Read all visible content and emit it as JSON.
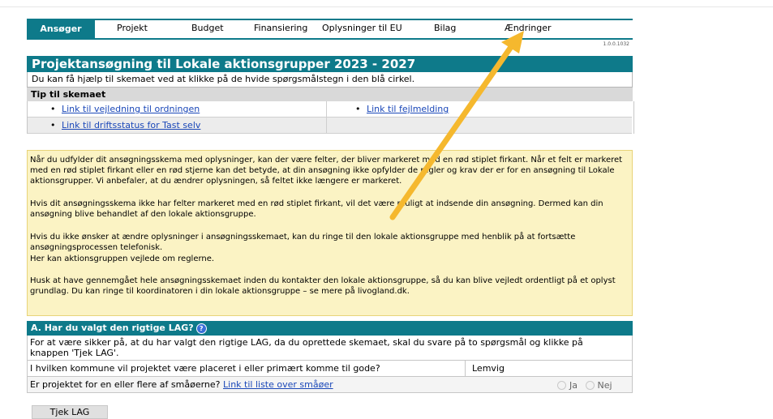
{
  "tabs": [
    "Ansøger",
    "Projekt",
    "Budget",
    "Finansiering",
    "Oplysninger til EU",
    "Bilag",
    "Ændringer"
  ],
  "active_tab": "Ansøger",
  "version": "1.0.0.1032",
  "title": "Projektansøgning til Lokale aktionsgrupper 2023 - 2027",
  "help_text": "Du kan få hjælp til skemaet ved at klikke på de hvide spørgsmålstegn i den blå cirkel.",
  "tips": {
    "heading": "Tip til skemaet",
    "links": {
      "guide": "Link til vejledning til ordningen",
      "error": "Link til fejlmelding",
      "status": "Link til driftsstatus for Tast selv"
    }
  },
  "notice": {
    "p1": "Når du udfylder dit ansøgningsskema med oplysninger, kan der være felter, der bliver markeret med en rød stiplet firkant. Når et felt er markeret med en rød stiplet firkant eller en rød stjerne kan det betyde, at din ansøgning ikke opfylder de regler og krav der er for en ansøgning til Lokale aktionsgrupper. Vi anbefaler, at du ændrer oplysningen, så feltet ikke længere er markeret.",
    "p2": "Hvis dit ansøgningsskema ikke har felter markeret med en rød stiplet firkant, vil det være muligt at indsende din ansøgning. Dermed kan din ansøgning blive behandlet af den lokale aktionsgruppe.",
    "p3": "Hvis du ikke ønsker at ændre oplysninger i ansøgningsskemaet, kan du ringe til den lokale aktionsgruppe med henblik på at fortsætte ansøgningsprocessen telefonisk.",
    "p3b": "Her kan aktionsgruppen vejlede om reglerne.",
    "p4": "Husk at have gennemgået hele ansøgningsskemaet inden du kontakter den lokale aktionsgruppe, så du kan blive vejledt ordentligt på et oplyst grundlag. Du kan ringe til koordinatoren i din lokale aktionsgruppe – se mere på livogland.dk."
  },
  "section_a": {
    "heading": "A. Har du valgt den rigtige LAG?",
    "help_icon": "?",
    "description": "For at være sikker på, at du har valgt den rigtige LAG, da du oprettede skemaet, skal du svare på to spørgsmål og klikke på knappen 'Tjek LAG'.",
    "q1": "I hvilken kommune vil projektet være placeret i eller primært komme til gode?",
    "q1_value": "Lemvig",
    "q2": "Er projektet for en eller flere af småøerne?",
    "q2_link": "Link til liste over småøer",
    "yes": "Ja",
    "no": "Nej",
    "q2_selected": "Nej",
    "button": "Tjek LAG"
  },
  "colors": {
    "teal": "#0e7a8a",
    "notice_bg": "#fbf3c4",
    "arrow": "#f5b82e",
    "link": "#1a47b8"
  }
}
